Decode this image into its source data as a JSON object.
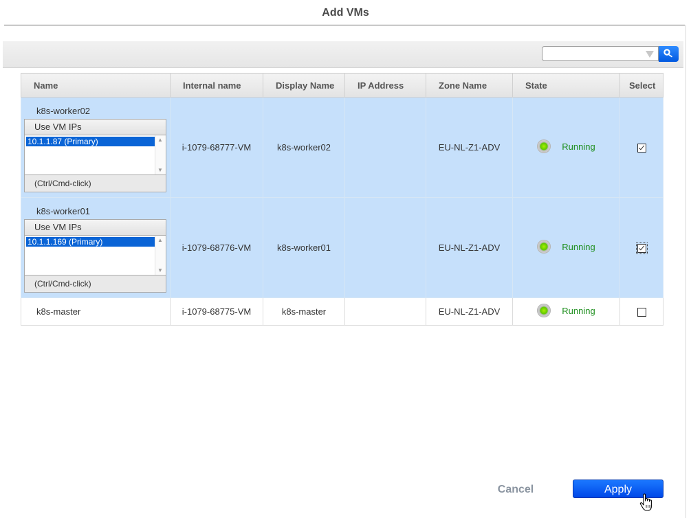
{
  "dialog": {
    "title": "Add VMs"
  },
  "search": {
    "value": "",
    "placeholder": ""
  },
  "columns": [
    "Name",
    "Internal name",
    "Display Name",
    "IP Address",
    "Zone Name",
    "State",
    "Select"
  ],
  "ip_selector": {
    "header": "Use VM IPs",
    "hint": "(Ctrl/Cmd-click)"
  },
  "rows": [
    {
      "name": "k8s-worker02",
      "ip": "10.1.1.87 (Primary)",
      "internal_name": "i-1079-68777-VM",
      "display_name": "k8s-worker02",
      "ip_address": "",
      "zone": "EU-NL-Z1-ADV",
      "state": "Running",
      "selected": true
    },
    {
      "name": "k8s-worker01",
      "ip": "10.1.1.169 (Primary)",
      "internal_name": "i-1079-68776-VM",
      "display_name": "k8s-worker01",
      "ip_address": "",
      "zone": "EU-NL-Z1-ADV",
      "state": "Running",
      "selected": true
    },
    {
      "name": "k8s-master",
      "internal_name": "i-1079-68775-VM",
      "display_name": "k8s-master",
      "ip_address": "",
      "zone": "EU-NL-Z1-ADV",
      "state": "Running",
      "selected": false
    }
  ],
  "buttons": {
    "cancel": "Cancel",
    "apply": "Apply"
  },
  "colors": {
    "selected_row": "#c6e0fb",
    "apply": "#0a5cf5",
    "running": "#1f8f1f"
  }
}
